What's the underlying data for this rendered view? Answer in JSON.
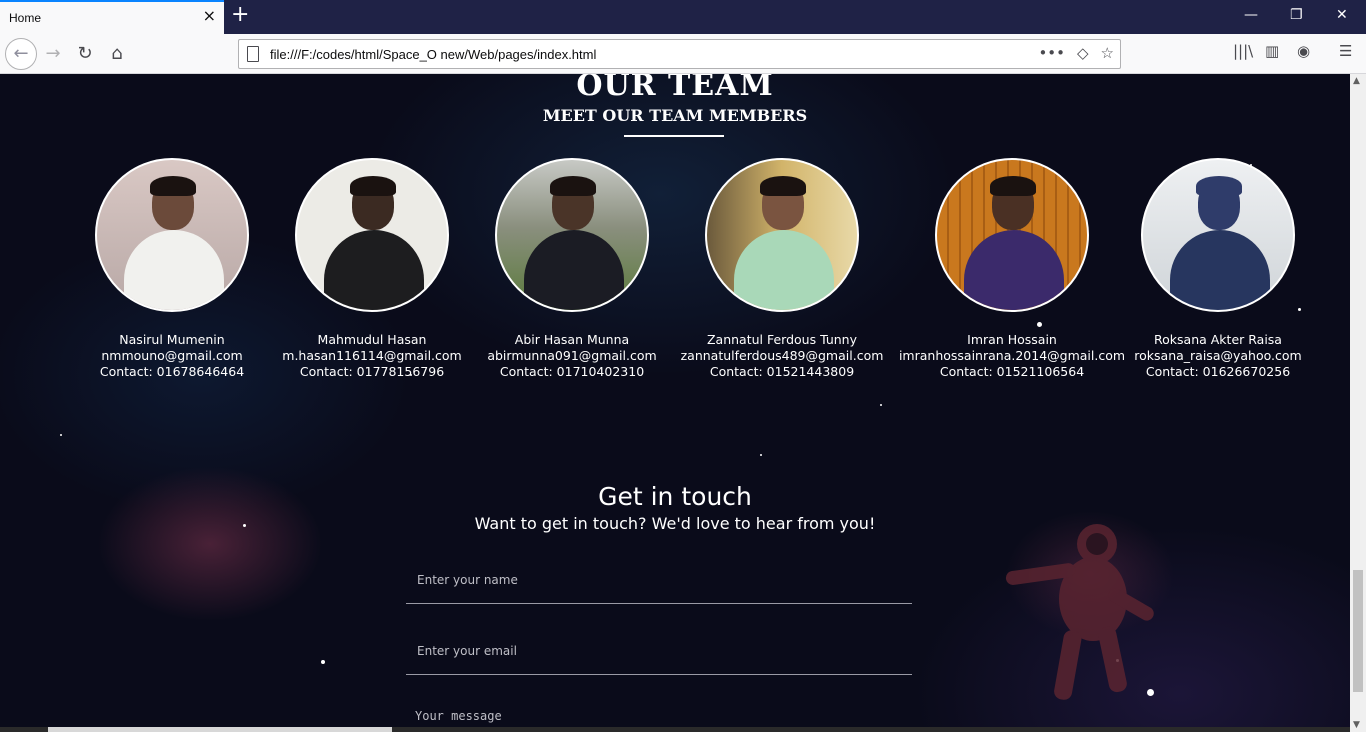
{
  "browser": {
    "tab_title": "Home",
    "tab_close": "×",
    "new_tab": "+",
    "window_controls": {
      "minimize": "—",
      "restore": "❐",
      "close": "✕"
    },
    "nav": {
      "back": "←",
      "forward": "→",
      "reload": "↻",
      "home": "⌂"
    },
    "url": "file:///F:/codes/html/Space_O new/Web/pages/index.html",
    "url_actions": {
      "more": "•••",
      "pocket": "◇",
      "bookmark": "☆"
    },
    "toolbar_right": {
      "library": "|||\\",
      "sidebar": "▥",
      "account": "◉",
      "menu": "☰"
    }
  },
  "team": {
    "heading": "OUR TEAM",
    "subheading": "MEET OUR TEAM MEMBERS",
    "members": [
      {
        "name": "Nasirul Mumenin",
        "email": "nmmouno@gmail.com",
        "contact": "Contact: 01678646464"
      },
      {
        "name": "Mahmudul Hasan",
        "email": "m.hasan116114@gmail.com",
        "contact": "Contact: 01778156796"
      },
      {
        "name": "Abir Hasan Munna",
        "email": "abirmunna091@gmail.com",
        "contact": "Contact: 01710402310"
      },
      {
        "name": "Zannatul Ferdous Tunny",
        "email": "zannatulferdous489@gmail.com",
        "contact": "Contact: 01521443809"
      },
      {
        "name": "Imran Hossain",
        "email": "imranhossainrana.2014@gmail.com",
        "contact": "Contact: 01521106564"
      },
      {
        "name": "Roksana Akter Raisa",
        "email": "roksana_raisa@yahoo.com",
        "contact": "Contact: 01626670256"
      }
    ]
  },
  "contact": {
    "title": "Get in touch",
    "subtitle": "Want to get in touch? We'd love to hear from you!",
    "name_placeholder": "Enter your name",
    "email_placeholder": "Enter your email",
    "message_placeholder": "Your message"
  },
  "colors": {
    "accent": "#0a84ff",
    "tabbar": "#1f2246",
    "page_bg": "#0a0b1a"
  },
  "icons": [
    "back-icon",
    "forward-icon",
    "reload-icon",
    "home-icon",
    "page-icon",
    "pocket-icon",
    "bookmark-icon",
    "library-icon",
    "sidebar-icon",
    "account-icon",
    "menu-icon"
  ]
}
